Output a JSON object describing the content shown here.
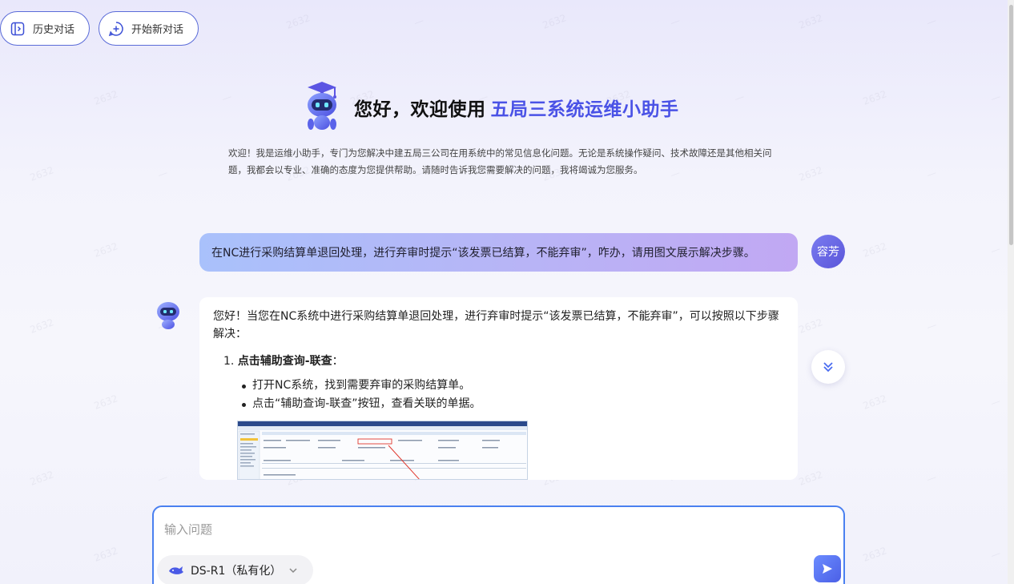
{
  "topbar": {
    "history_label": "历史对话",
    "new_chat_label": "开始新对话"
  },
  "hero": {
    "greeting": "您好，欢迎使用",
    "brand": "五局三系统运维小助手"
  },
  "intro": {
    "text": "欢迎！我是运维小助手，专门为您解决中建五局三公司在用系统中的常见信息化问题。无论是系统操作疑问、技术故障还是其他相关问题，我都会以专业、准确的态度为您提供帮助。请随时告诉我您需要解决的问题，我将竭诚为您服务。"
  },
  "conversation": {
    "user_message": "在NC进行采购结算单退回处理，进行弃审时提示“该发票已结算，不能弃审”，咋办，请用图文展示解决步骤。",
    "user_avatar_text": "容芳",
    "bot_reply": {
      "intro": "您好！当您在NC系统中进行采购结算单退回处理，进行弃审时提示“该发票已结算，不能弃审”，可以按照以下步骤解决：",
      "step1_number": "1.",
      "step1_title": "点击辅助查询-联查",
      "step1_colon": "：",
      "step1_bullets": [
        "打开NC系统，找到需要弃审的采购结算单。",
        "点击“辅助查询-联查”按钮，查看关联的单据。"
      ]
    }
  },
  "composer": {
    "placeholder": "输入问题",
    "model_label": "DS-R1（私有化）"
  },
  "icons": {
    "history": "sidebar-toggle-icon",
    "new_chat": "plus-circle-icon",
    "scroll_down": "double-chevron-down-icon",
    "send": "send-icon",
    "model": "whale-icon",
    "model_dropdown": "chevron-down-icon"
  },
  "colors": {
    "accent": "#4a52e6",
    "border": "#4a80f0",
    "user_bubble_start": "#a9c1fb",
    "user_bubble_end": "#c1a8f3"
  }
}
